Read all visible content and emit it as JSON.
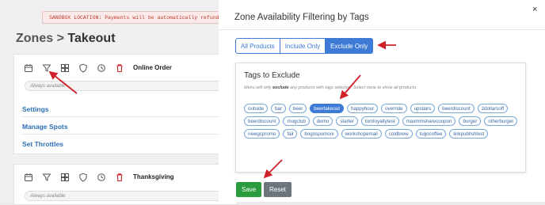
{
  "sandbox_notice": "SANDBOX LOCATION: Payments will be automatically refunded",
  "breadcrumb": {
    "parent": "Zones",
    "separator": ">",
    "current": "Takeout"
  },
  "zones": [
    {
      "title": "Online Order",
      "availability": "Always available",
      "links": [
        "Settings",
        "Manage Spots",
        "Set Throttles"
      ]
    },
    {
      "title": "Thanksgiving",
      "availability": "Always available"
    }
  ],
  "zone_icons": [
    "calendar-icon",
    "filter-icon",
    "grid-icon",
    "shield-icon",
    "history-icon",
    "trash-icon"
  ],
  "modal": {
    "title": "Zone Availability Filtering by Tags",
    "close": "×",
    "filter_modes": [
      {
        "label": "All Products",
        "active": false
      },
      {
        "label": "Include Only",
        "active": false
      },
      {
        "label": "Exclude Only",
        "active": true
      }
    ],
    "section_title": "Tags to Exclude",
    "description_pre": "Menu will only ",
    "description_bold": "exclude",
    "description_post": " any products with tags selected. Select none to show all products.",
    "tags": [
      {
        "label": "outside",
        "selected": false
      },
      {
        "label": "bar",
        "selected": false
      },
      {
        "label": "beer",
        "selected": false
      },
      {
        "label": "beertakeout",
        "selected": true
      },
      {
        "label": "happyhour",
        "selected": false
      },
      {
        "label": "override",
        "selected": false
      },
      {
        "label": "upstairs",
        "selected": false
      },
      {
        "label": "beerdiscount",
        "selected": false
      },
      {
        "label": "2dollarsoff",
        "selected": false
      },
      {
        "label": "beerdiscount",
        "selected": false
      },
      {
        "label": "mugclub",
        "selected": false
      },
      {
        "label": "demo",
        "selected": false
      },
      {
        "label": "starter",
        "selected": false
      },
      {
        "label": "tomloyaltytest",
        "selected": false
      },
      {
        "label": "maxmmsharecoopon",
        "selected": false
      },
      {
        "label": "burger",
        "selected": false
      },
      {
        "label": "otherburger",
        "selected": false
      },
      {
        "label": "newgcpromo",
        "selected": false
      },
      {
        "label": "fail",
        "selected": false
      },
      {
        "label": "bogospumoni",
        "selected": false
      },
      {
        "label": "workshopemail",
        "selected": false
      },
      {
        "label": "coldbrew",
        "selected": false
      },
      {
        "label": "togocoffee",
        "selected": false
      },
      {
        "label": "linkpublishtest",
        "selected": false
      }
    ],
    "save_label": "Save",
    "reset_label": "Reset"
  },
  "colors": {
    "accent": "#3d7bd6",
    "save": "#2b9b3e",
    "reset": "#6c757d",
    "annotation": "#d0202a"
  }
}
